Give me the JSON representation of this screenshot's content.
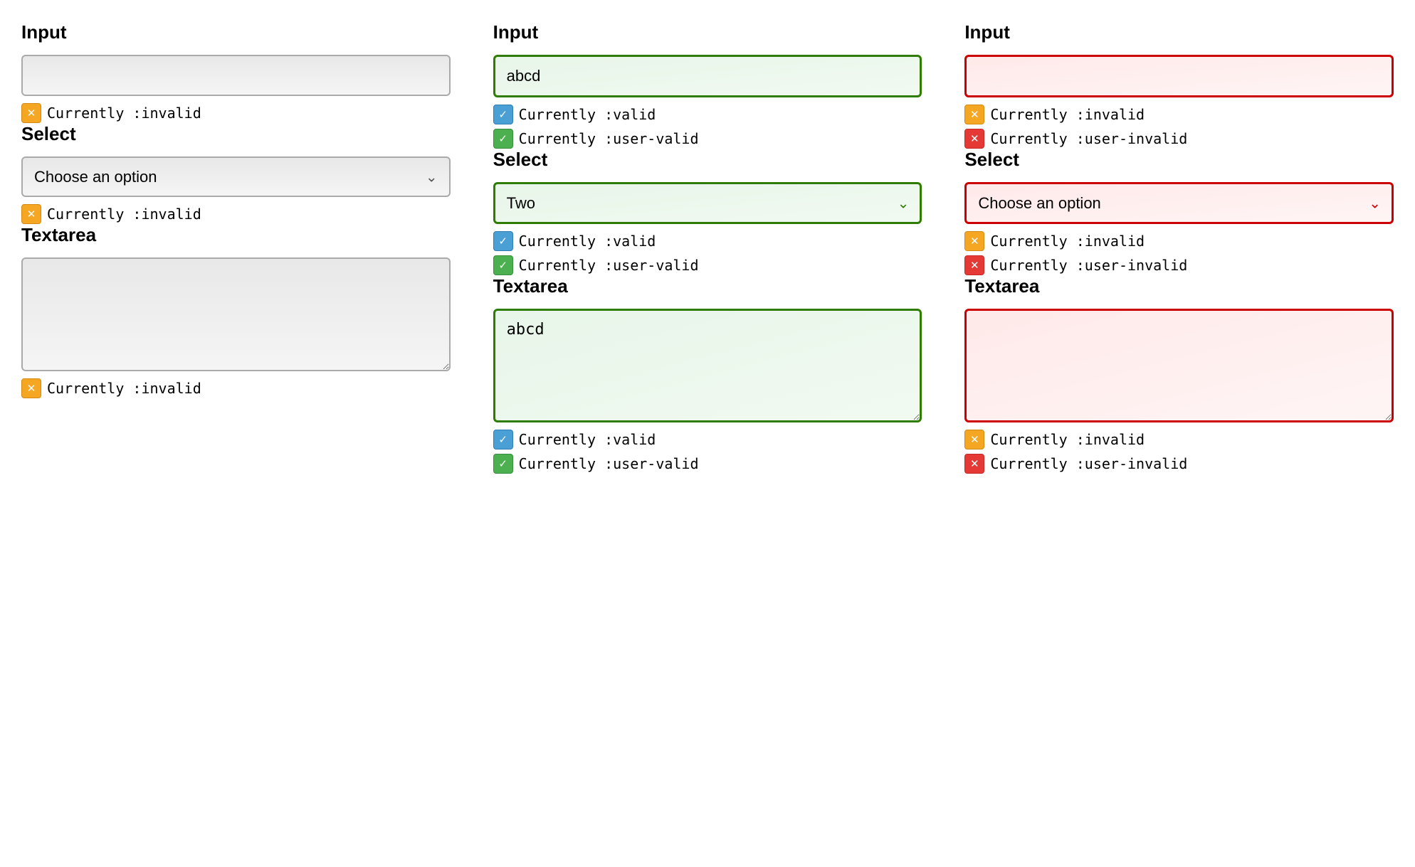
{
  "columns": [
    {
      "id": "default",
      "sections": [
        {
          "type": "input",
          "label": "Input",
          "value": "",
          "style": "default",
          "statuses": [
            {
              "icon": "orange-x",
              "text": "Currently :invalid"
            }
          ]
        },
        {
          "type": "select",
          "label": "Select",
          "value": "Choose an option",
          "style": "default",
          "chevron_style": "default",
          "statuses": [
            {
              "icon": "orange-x",
              "text": "Currently :invalid"
            }
          ]
        },
        {
          "type": "textarea",
          "label": "Textarea",
          "value": "",
          "style": "default",
          "statuses": [
            {
              "icon": "orange-x",
              "text": "Currently :invalid"
            }
          ]
        }
      ]
    },
    {
      "id": "valid",
      "sections": [
        {
          "type": "input",
          "label": "Input",
          "value": "abcd",
          "style": "valid",
          "statuses": [
            {
              "icon": "blue-check",
              "text": "Currently :valid"
            },
            {
              "icon": "green-check",
              "text": "Currently :user-valid"
            }
          ]
        },
        {
          "type": "select",
          "label": "Select",
          "value": "Two",
          "style": "valid",
          "chevron_style": "valid",
          "statuses": [
            {
              "icon": "blue-check",
              "text": "Currently :valid"
            },
            {
              "icon": "green-check",
              "text": "Currently :user-valid"
            }
          ]
        },
        {
          "type": "textarea",
          "label": "Textarea",
          "value": "abcd",
          "style": "valid",
          "statuses": [
            {
              "icon": "blue-check",
              "text": "Currently :valid"
            },
            {
              "icon": "green-check",
              "text": "Currently :user-valid"
            }
          ]
        }
      ]
    },
    {
      "id": "invalid-red",
      "sections": [
        {
          "type": "input",
          "label": "Input",
          "value": "",
          "style": "invalid-red",
          "statuses": [
            {
              "icon": "orange-x",
              "text": "Currently :invalid"
            },
            {
              "icon": "red-x",
              "text": "Currently :user-invalid"
            }
          ]
        },
        {
          "type": "select",
          "label": "Select",
          "value": "Choose an option",
          "style": "invalid-red",
          "chevron_style": "invalid",
          "statuses": [
            {
              "icon": "orange-x",
              "text": "Currently :invalid"
            },
            {
              "icon": "red-x",
              "text": "Currently :user-invalid"
            }
          ]
        },
        {
          "type": "textarea",
          "label": "Textarea",
          "value": "",
          "style": "invalid-red",
          "statuses": [
            {
              "icon": "orange-x",
              "text": "Currently :invalid"
            },
            {
              "icon": "red-x",
              "text": "Currently :user-invalid"
            }
          ]
        }
      ]
    }
  ]
}
